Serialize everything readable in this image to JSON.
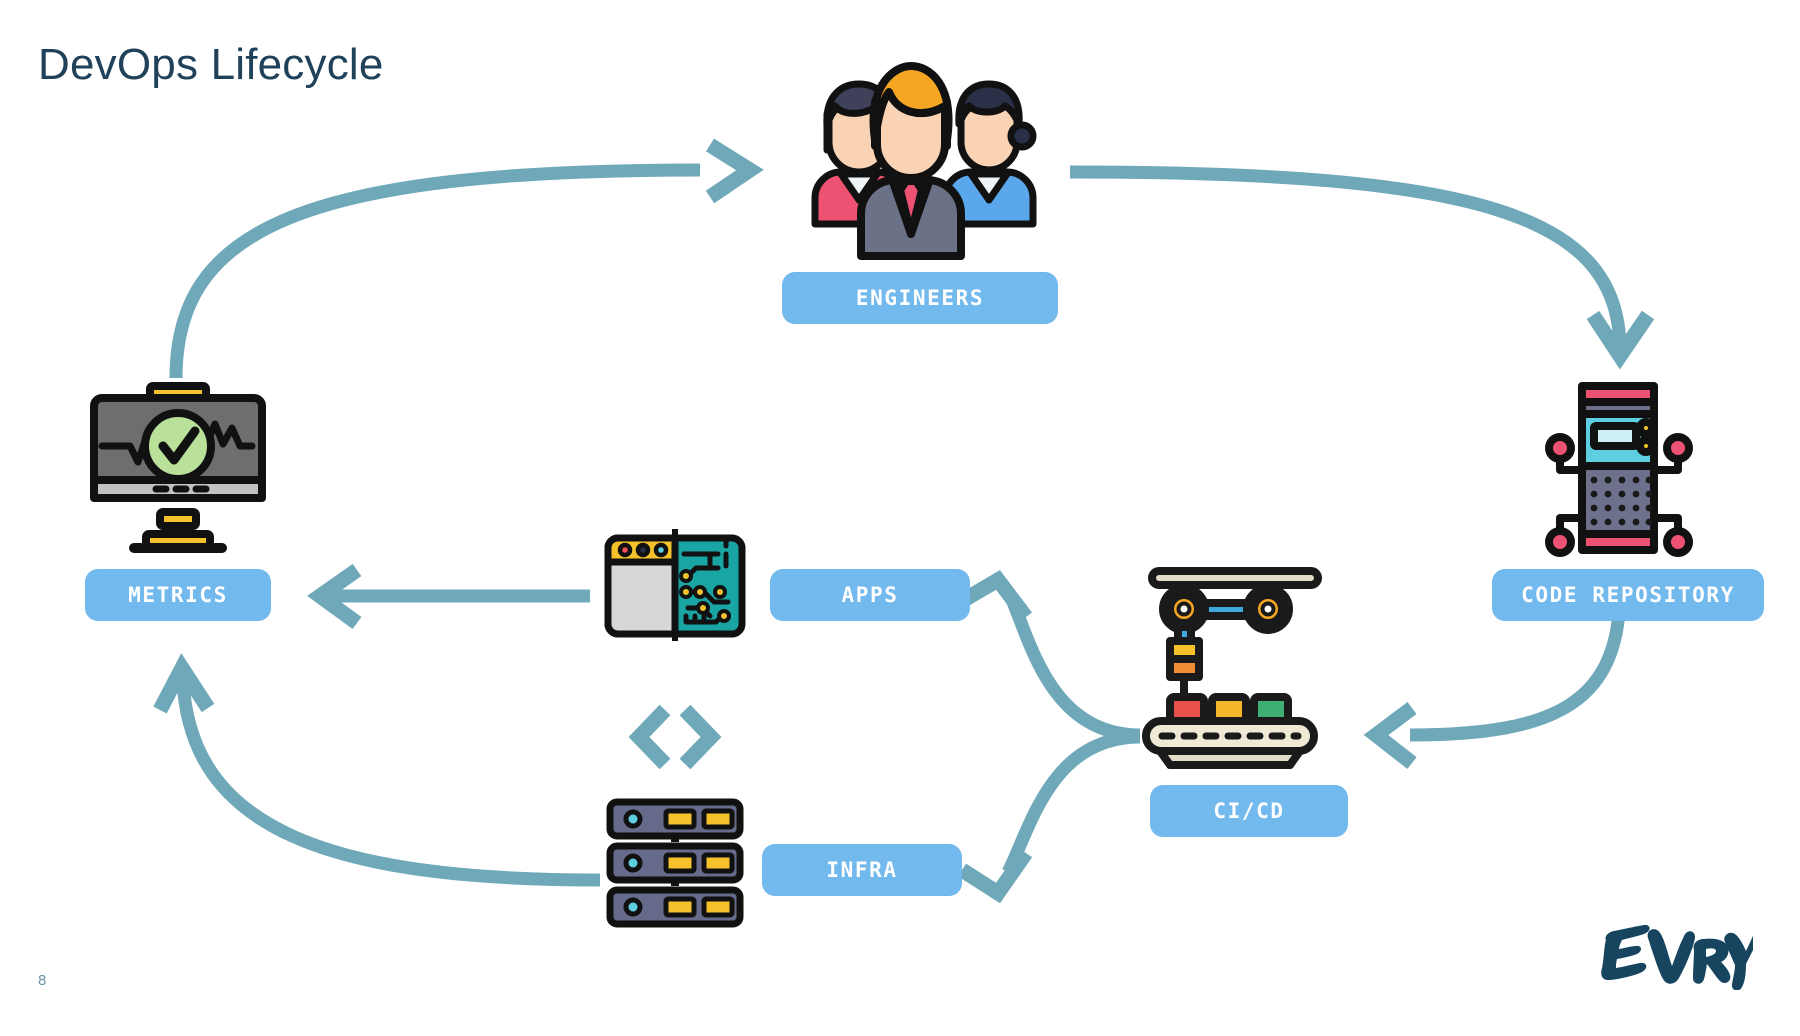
{
  "slide": {
    "title": "DevOps Lifecycle",
    "page_number": "8",
    "brand_logo_text": "EVRY",
    "background_color": "#FFFFFF"
  },
  "theme": {
    "title_color": "#1F4159",
    "pill_background": "#72B9EE",
    "pill_text_color": "#FFFFFF",
    "arrow_color": "#6FA8B8",
    "page_number_color": "#6A93A6",
    "logo_color": "#17455F"
  },
  "nodes": [
    {
      "id": "engineers",
      "label": "ENGINEERS",
      "icon": "team-of-people-icon",
      "position": "top-center"
    },
    {
      "id": "code_repository",
      "label": "CODE REPOSITORY",
      "icon": "server-tower-icon",
      "position": "right"
    },
    {
      "id": "cicd",
      "label": "CI/CD",
      "icon": "robotic-arm-conveyor-icon",
      "position": "center-right"
    },
    {
      "id": "apps",
      "label": "APPS",
      "icon": "app-window-circuit-icon",
      "position": "center"
    },
    {
      "id": "infra",
      "label": "INFRA",
      "icon": "server-rack-icon",
      "position": "center-bottom"
    },
    {
      "id": "metrics",
      "label": "METRICS",
      "icon": "monitor-heartbeat-check-icon",
      "position": "left"
    }
  ],
  "decorative_icons": [
    {
      "id": "code_tag",
      "icon": "code-brackets-icon"
    }
  ],
  "flow_arrows": [
    {
      "from": "metrics",
      "to": "engineers"
    },
    {
      "from": "engineers",
      "to": "code_repository"
    },
    {
      "from": "code_repository",
      "to": "cicd"
    },
    {
      "from": "cicd",
      "to": "apps"
    },
    {
      "from": "cicd",
      "to": "infra"
    },
    {
      "from": "apps",
      "to": "metrics"
    },
    {
      "from": "infra",
      "to": "metrics"
    }
  ]
}
